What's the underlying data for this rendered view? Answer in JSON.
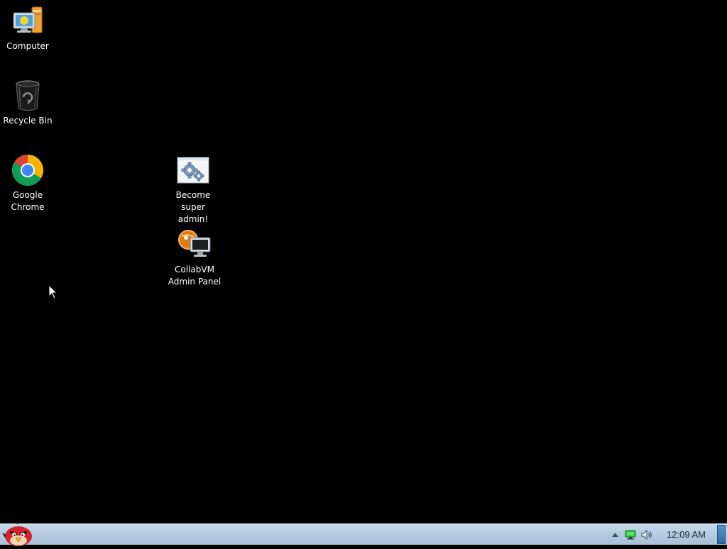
{
  "desktop": {
    "background": "#000000",
    "icons": [
      {
        "id": "computer",
        "label": "Computer",
        "icon": "computer-icon"
      },
      {
        "id": "recycle-bin",
        "label": "Recycle Bin",
        "icon": "recycle-bin-icon"
      },
      {
        "id": "google-chrome",
        "label": "Google Chrome",
        "icon": "chrome-icon"
      },
      {
        "id": "become-super-admin",
        "label": "Become super admin!",
        "icon": "gears-settings-icon"
      },
      {
        "id": "collabvm-admin-panel",
        "label": "CollabVM Admin Panel",
        "icon": "collabvm-monitor-icon"
      }
    ]
  },
  "taskbar": {
    "start_icon": "angry-bird-start-icon",
    "tray": {
      "arrow_icon": "show-hidden-icons-arrow",
      "network_icon": "network-icon",
      "volume_icon": "volume-icon",
      "clock": "12:09 AM"
    },
    "colors": {
      "taskbar_top": "#c9dcec",
      "taskbar_bottom": "#a9c2da",
      "show_desktop": "#2e6aa6"
    }
  }
}
